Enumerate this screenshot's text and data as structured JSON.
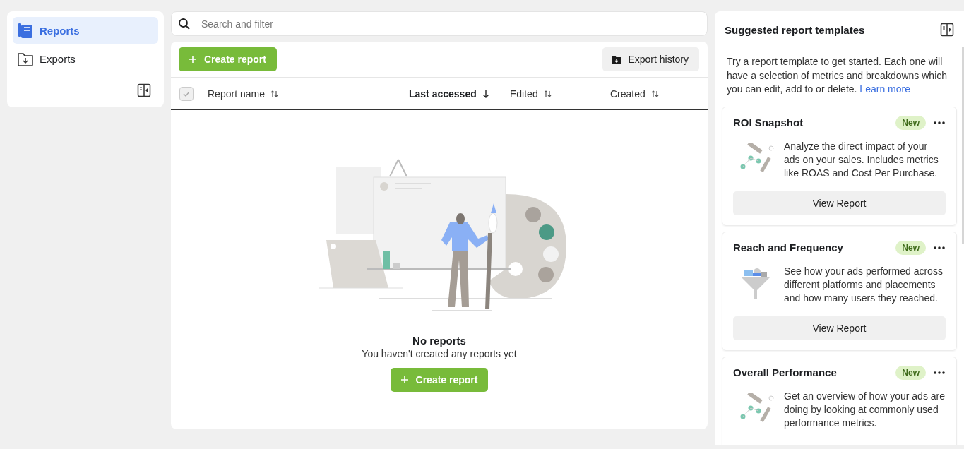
{
  "sidebar": {
    "items": [
      {
        "label": "Reports",
        "kind": "reports",
        "selected": true
      },
      {
        "label": "Exports",
        "kind": "exports",
        "selected": false
      }
    ]
  },
  "search": {
    "placeholder": "Search and filter"
  },
  "toolbar": {
    "create_button": "Create report",
    "export_button": "Export history"
  },
  "table": {
    "select_all": {
      "disabled": true
    },
    "columns": [
      {
        "label": "Report name",
        "selected": false
      },
      {
        "label": "Last accessed",
        "selected": true
      },
      {
        "label": "Edited",
        "selected": false
      },
      {
        "label": "Created",
        "selected": false
      }
    ]
  },
  "empty_state": {
    "title": "No reports",
    "message": "You haven't created any reports yet",
    "button": "Create report"
  },
  "templates_panel": {
    "title": "Suggested report templates",
    "intro": "Try a report template to get started. Each one will have a selection of metrics and breakdowns which you can edit, add to or delete.",
    "link": "Learn more",
    "cards": [
      {
        "title": "ROI Snapshot",
        "badge": "New",
        "kind": "chart",
        "description": "Analyze the direct impact of your ads on your sales. Includes metrics like ROAS and Cost Per Purchase.",
        "button": "View Report"
      },
      {
        "title": "Reach and Frequency",
        "badge": "New",
        "kind": "funnel",
        "description": "See how your ads performed across different platforms and placements and how many users they reached.",
        "button": "View Report"
      },
      {
        "title": "Overall Performance",
        "badge": "New",
        "kind": "chart",
        "description": "Get an overview of how your ads are doing by looking at commonly used performance metrics."
      }
    ]
  }
}
